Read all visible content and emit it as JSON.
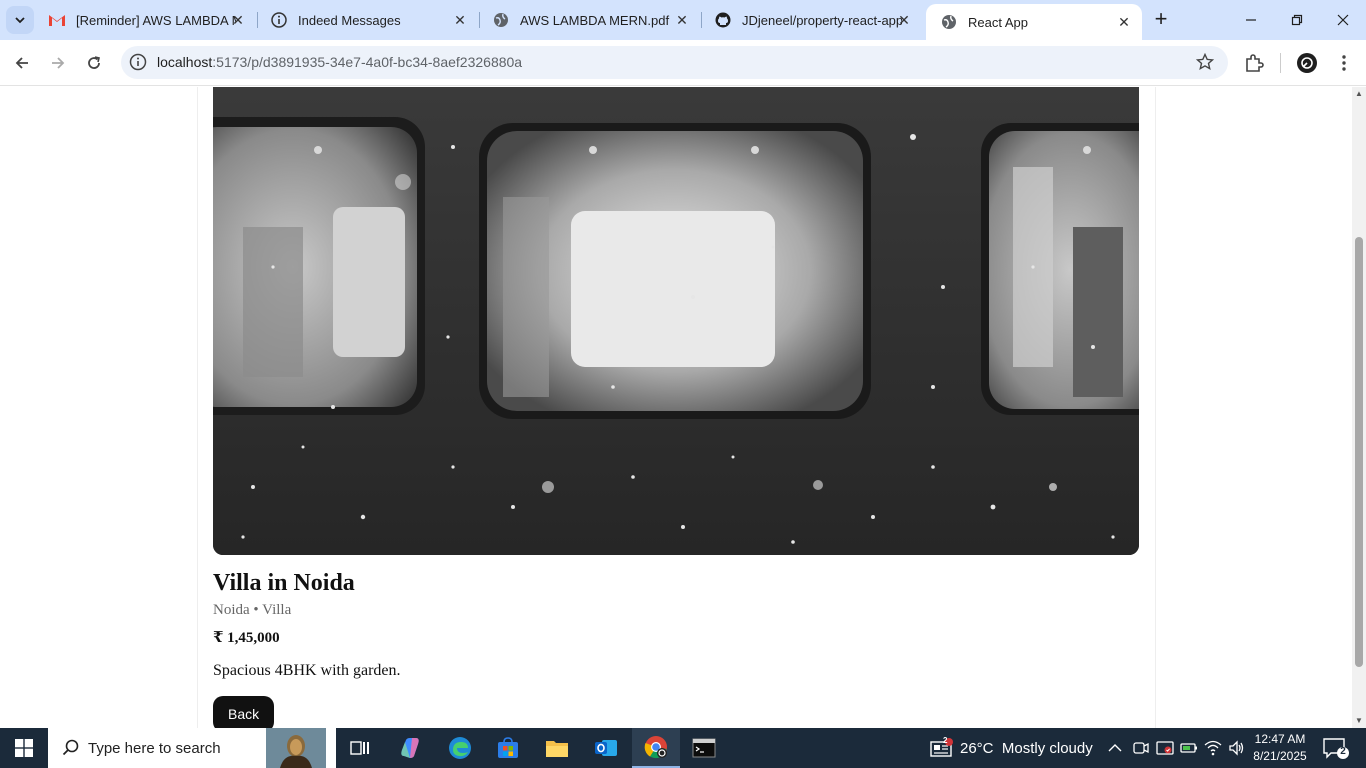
{
  "browser": {
    "tabs": [
      {
        "title": "[Reminder] AWS LAMBDA M",
        "icon": "gmail-icon",
        "active": false
      },
      {
        "title": "Indeed Messages",
        "icon": "info-icon",
        "active": false
      },
      {
        "title": "AWS LAMBDA MERN.pdf",
        "icon": "globe-icon",
        "active": false
      },
      {
        "title": "JDjeneel/property-react-app",
        "icon": "github-icon",
        "active": false
      },
      {
        "title": "React App",
        "icon": "globe-icon",
        "active": true
      }
    ],
    "url_host": "localhost",
    "url_path": ":5173/p/d3891935-34e7-4a0f-bc34-8aef2326880a"
  },
  "property": {
    "title": "Villa in Noida",
    "meta": "Noida • Villa",
    "price": "₹ 1,45,000",
    "description": "Spacious 4BHK with garden.",
    "back_label": "Back"
  },
  "taskbar": {
    "search_placeholder": "Type here to search",
    "weather": "26°C  Mostly cloudy",
    "weather_badge": "2",
    "time": "12:47 AM",
    "date": "8/21/2025",
    "notification_count": "2"
  },
  "colors": {
    "tabstrip": "#d3e3fd",
    "omnibox": "#edf2fa",
    "taskbar": "#1b2a3a",
    "button": "#111111"
  }
}
